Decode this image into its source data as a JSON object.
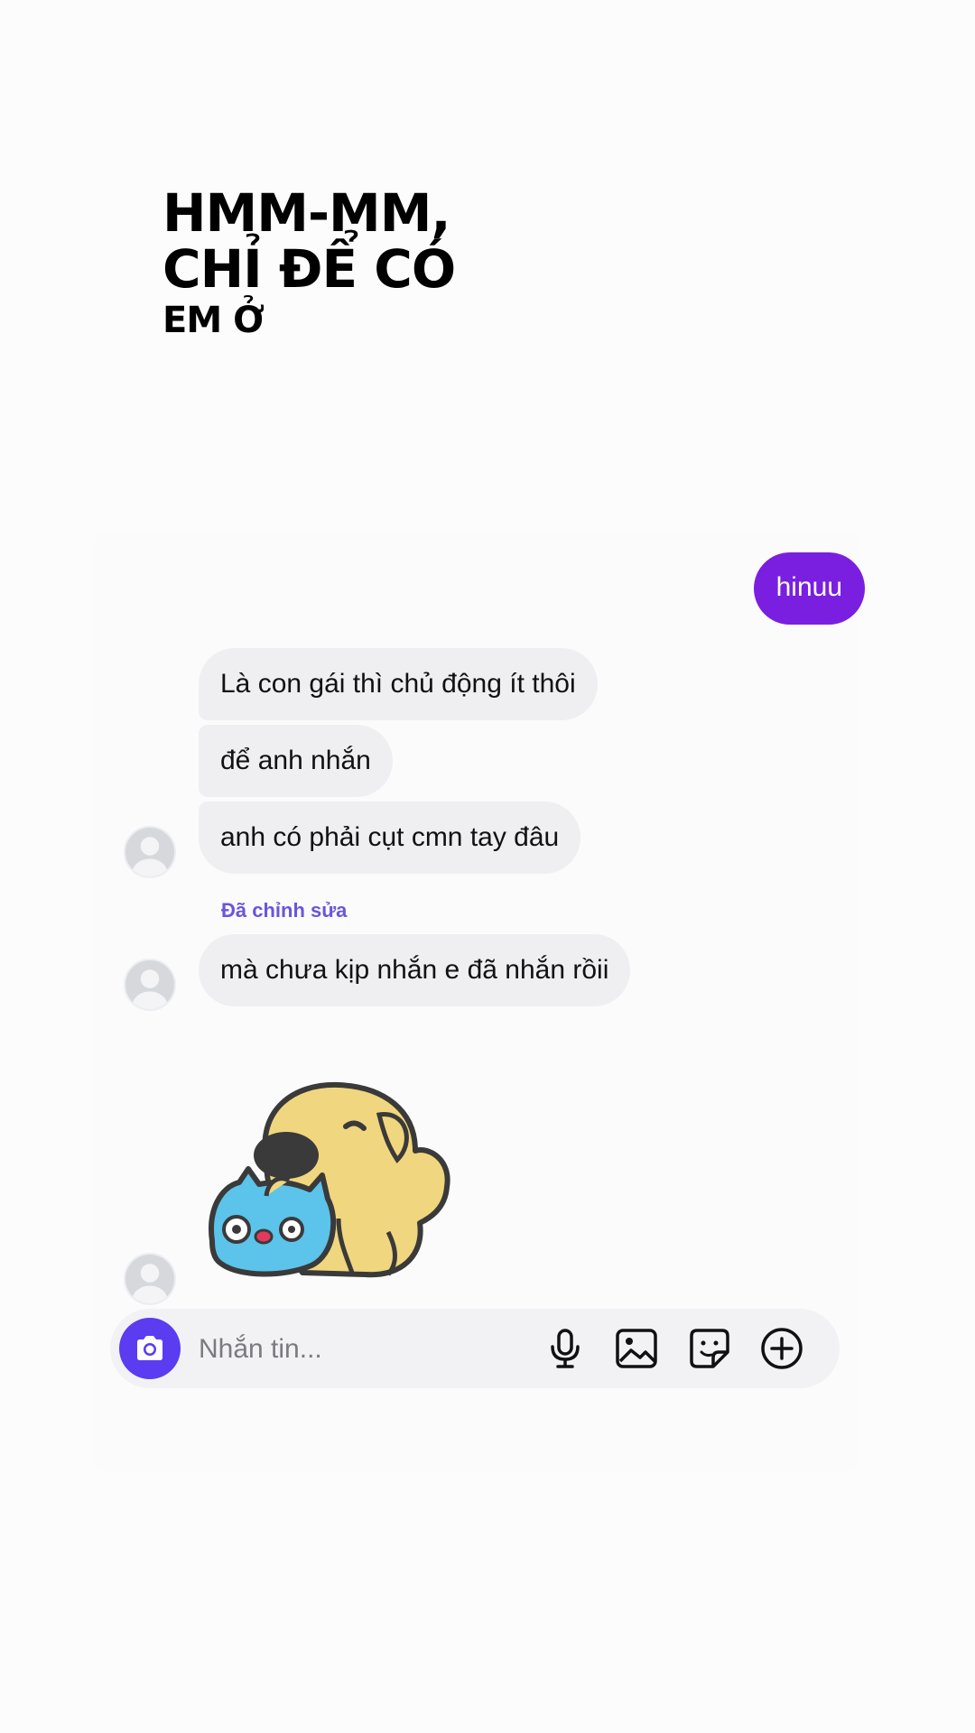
{
  "caption": {
    "line1": "HMM-MM,",
    "line2": "CHỈ ĐỂ CÓ",
    "line3": "EM Ở"
  },
  "messages": {
    "outgoing": "hinuu",
    "incoming": [
      "Là con gái thì chủ động ít thôi",
      "để anh nhắn",
      "anh có phải cụt cmn tay đâu"
    ],
    "edited_label": "Đã chỉnh sửa",
    "edited_message": "mà chưa kịp nhắn e đã nhắn rồii"
  },
  "composer": {
    "placeholder": "Nhắn tin...",
    "icons": [
      "camera-icon",
      "microphone-icon",
      "image-icon",
      "sticker-icon",
      "plus-icon"
    ]
  },
  "colors": {
    "outgoing_bubble": "#7a1fe0",
    "camera_button": "#5b3cf0",
    "edited_label": "#6b55d8",
    "incoming_bubble": "#efeff1"
  }
}
